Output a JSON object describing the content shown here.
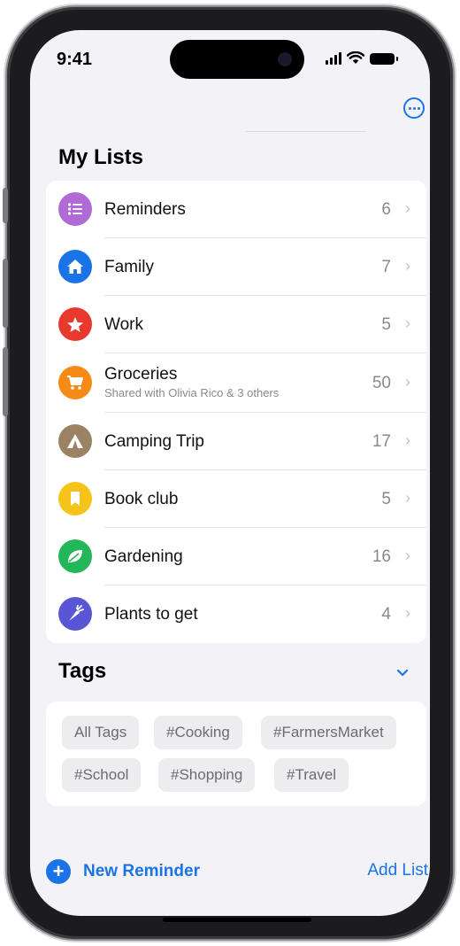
{
  "status_bar": {
    "time": "9:41"
  },
  "my_lists": {
    "title": "My Lists",
    "items": [
      {
        "name": "Reminders",
        "count": "6",
        "color": "#b06ad6",
        "icon": "list-bullet-icon"
      },
      {
        "name": "Family",
        "count": "7",
        "color": "#1a74e8",
        "icon": "house-icon"
      },
      {
        "name": "Work",
        "count": "5",
        "color": "#e8392f",
        "icon": "star-icon"
      },
      {
        "name": "Groceries",
        "subtitle": "Shared with Olivia Rico & 3 others",
        "count": "50",
        "color": "#f58b14",
        "icon": "cart-icon"
      },
      {
        "name": "Camping Trip",
        "count": "17",
        "color": "#9b8263",
        "icon": "tent-icon"
      },
      {
        "name": "Book club",
        "count": "5",
        "color": "#f6c318",
        "icon": "bookmark-icon"
      },
      {
        "name": "Gardening",
        "count": "16",
        "color": "#21b75a",
        "icon": "leaf-icon"
      },
      {
        "name": "Plants to get",
        "count": "4",
        "color": "#5956d6",
        "icon": "carrot-icon"
      }
    ]
  },
  "tags": {
    "title": "Tags",
    "items": [
      "All Tags",
      "#Cooking",
      "#FarmersMarket",
      "#School",
      "#Shopping",
      "#Travel"
    ]
  },
  "toolbar": {
    "new_reminder": "New Reminder",
    "add_list": "Add List"
  },
  "colors": {
    "accent": "#1a74e8",
    "background": "#f2f2f7"
  }
}
